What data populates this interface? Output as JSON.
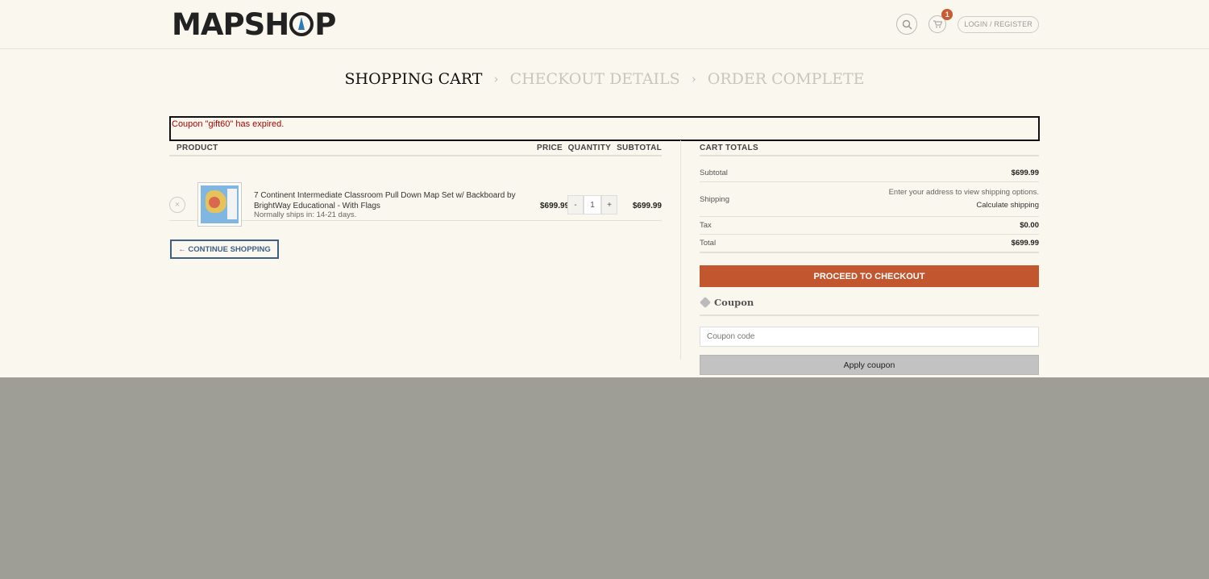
{
  "header": {
    "logo": "MAPSHOP",
    "cart_count": "1",
    "login_label": "LOGIN / REGISTER"
  },
  "steps": [
    "SHOPPING CART",
    "CHECKOUT DETAILS",
    "ORDER COMPLETE"
  ],
  "notice": "Coupon \"gift60\" has expired.",
  "table": {
    "headers": [
      "PRODUCT",
      "PRICE",
      "QUANTITY",
      "SUBTOTAL"
    ],
    "rows": [
      {
        "remove": "×",
        "name": "7 Continent Intermediate Classroom Pull Down Map Set w/ Backboard by BrightWay Educational - With Flags",
        "shipping": "Normally ships in: 14-21 days.",
        "price": "$699.99",
        "qty_minus": "-",
        "qty": "1",
        "qty_plus": "+",
        "subtotal": "$699.99"
      }
    ]
  },
  "continue_label": "← CONTINUE SHOPPING",
  "totals": {
    "heading": "CART TOTALS",
    "subtotal_label": "Subtotal",
    "subtotal": "$699.99",
    "shipping_label": "Shipping",
    "shipping_note": "Enter your address to view shipping options.",
    "calc_shipping": "Calculate shipping",
    "tax_label": "Tax",
    "tax": "$0.00",
    "total_label": "Total",
    "total": "$699.99",
    "checkout_label": "PROCEED TO CHECKOUT"
  },
  "coupon": {
    "heading": "Coupon",
    "placeholder": "Coupon code",
    "apply_label": "Apply coupon"
  },
  "colors": {
    "accent": "#c1562f",
    "notice_text": "#b20000",
    "nav_blue": "#3f5f86"
  }
}
